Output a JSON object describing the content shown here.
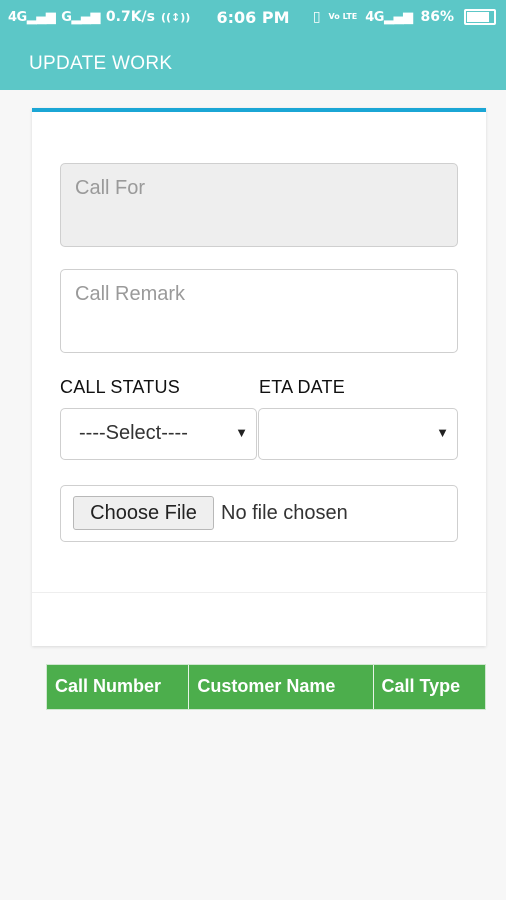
{
  "statusbar": {
    "network1": "4G",
    "network2": "G",
    "speed": "0.7K/s",
    "time": "6:06 PM",
    "volte": "Vo LTE",
    "network3": "4G",
    "battery_percent": "86%",
    "battery_level": 0.86
  },
  "appbar": {
    "title": "UPDATE WORK"
  },
  "form": {
    "call_for_placeholder": "Call For",
    "call_remark_placeholder": "Call Remark",
    "call_status_label": "CALL STATUS",
    "eta_date_label": "ETA DATE",
    "call_status_value": "----Select----",
    "eta_date_value": "",
    "choose_file_label": "Choose File",
    "file_status": "No file chosen"
  },
  "table": {
    "headers": [
      "Call Number",
      "Customer Name",
      "Call Type"
    ]
  },
  "colors": {
    "primary": "#5cc7c7",
    "card_accent": "#1ba6d5",
    "table_header": "#4cae4c"
  }
}
